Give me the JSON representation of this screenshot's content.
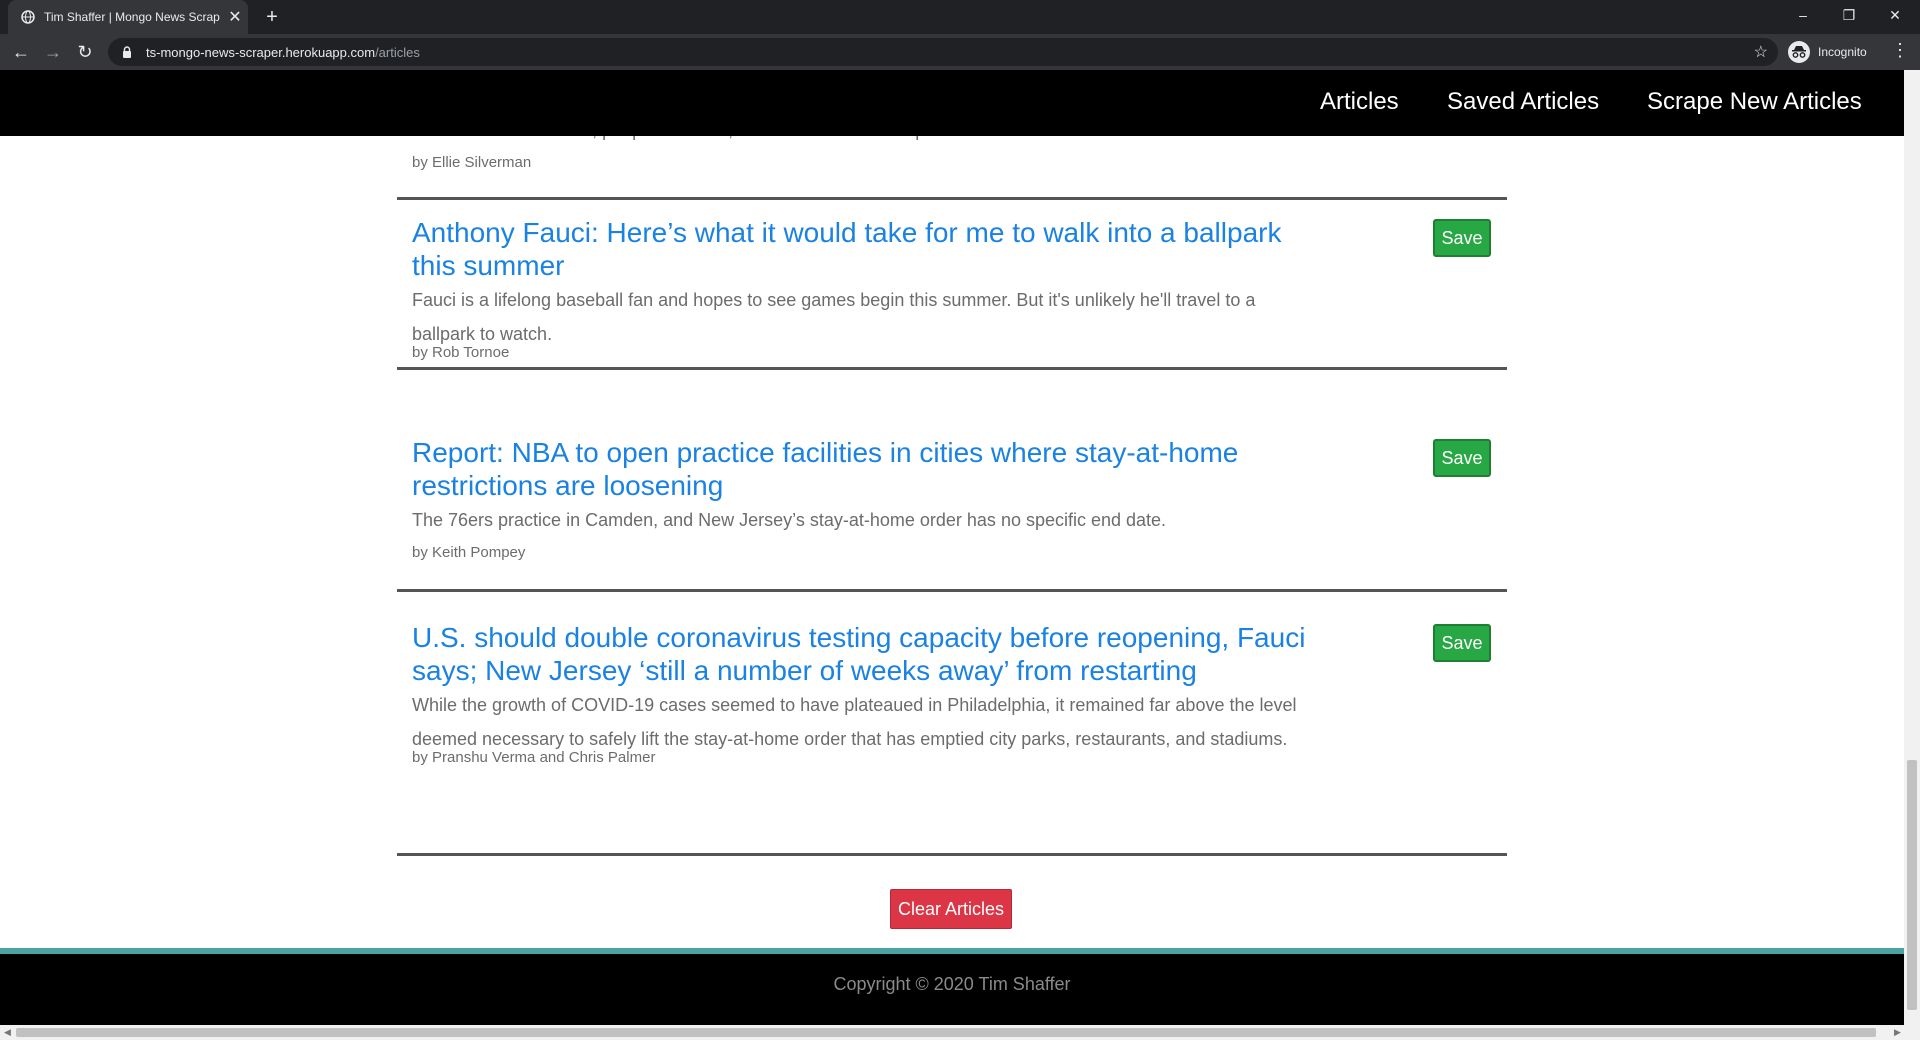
{
  "browser": {
    "tab_title": "Tim Shaffer | Mongo News Scraper",
    "url_host": "ts-mongo-news-scraper.herokuapp.com",
    "url_path": "/articles",
    "profile_label": "Incognito",
    "close_glyph": "✕",
    "new_tab_glyph": "+",
    "back_glyph": "←",
    "forward_glyph": "→",
    "reload_glyph": "↻",
    "star_glyph": "☆",
    "menu_glyph": "⋮",
    "minimize_glyph": "–",
    "restore_glyph": "❐",
    "window_close_glyph": "✕"
  },
  "nav": {
    "articles": "Articles",
    "saved_articles": "Saved Articles",
    "scrape_new": "Scrape New Articles"
  },
  "partial_article": {
    "summary": "At our most vulnerable, people now see, the coronavirus will separate us from those we love.",
    "byline": "by Ellie Silverman"
  },
  "articles": [
    {
      "headline": "Anthony Fauci: Here’s what it would take for me to walk into a ballpark this summer",
      "summary": "Fauci is a lifelong baseball fan and hopes to see games begin this summer. But it's unlikely he'll travel to a ballpark to watch.",
      "byline": "by Rob Tornoe",
      "save_label": "Save"
    },
    {
      "headline": "Report: NBA to open practice facilities in cities where stay-at-home restrictions are loosening",
      "summary": "The 76ers practice in Camden, and New Jersey’s stay-at-home order has no specific end date.",
      "byline": "by Keith Pompey",
      "save_label": "Save"
    },
    {
      "headline": "U.S. should double coronavirus testing capacity before reopening, Fauci says; New Jersey ‘still a number of weeks away’ from restarting",
      "summary": "While the growth of COVID-19 cases seemed to have plateaued in Philadelphia, it remained far above the level deemed necessary to safely lift the stay-at-home order that has emptied city parks, restaurants, and stadiums.",
      "byline": "by Pranshu Verma and Chris Palmer",
      "save_label": "Save"
    }
  ],
  "clear_button": "Clear Articles",
  "footer": {
    "copyright": "Copyright © 2020 Tim Shaffer"
  },
  "colors": {
    "headline": "#1a82e2",
    "save_button": "#28a745",
    "clear_button": "#dc3545",
    "footer_accent": "#4aa3a3"
  }
}
